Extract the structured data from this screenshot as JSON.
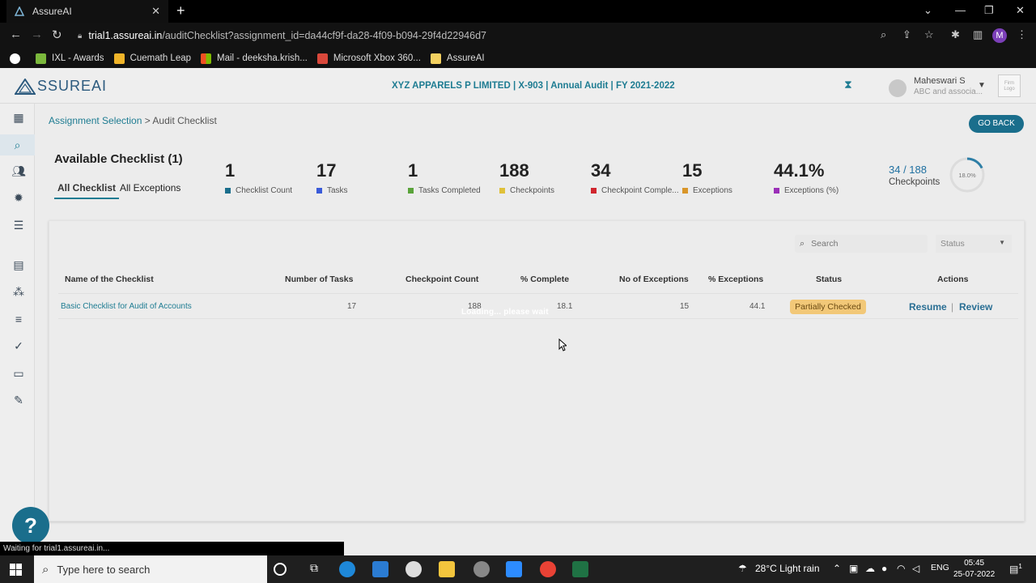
{
  "browser": {
    "tab_title": "AssureAI",
    "url_domain": "trial1.assureai.in",
    "url_path": "/auditChecklist?assignment_id=da44cf9f-da28-4f09-b094-29f4d22946d7",
    "profile_initial": "M",
    "bookmarks": [
      "IXL - Awards",
      "Cuemath Leap",
      "Mail - deeksha.krish...",
      "Microsoft Xbox 360...",
      "AssureAI"
    ],
    "status_text": "Waiting for trial1.assureai.in..."
  },
  "app": {
    "logo_text": "SSUREAI",
    "context": "XYZ APPARELS P LIMITED | X-903 | Annual Audit | FY 2021-2022",
    "user_name": "Maheswari S",
    "user_org": "ABC and associa...",
    "firm_logo_text": "Firm Logo"
  },
  "breadcrumb": {
    "link": "Assignment Selection",
    "sep": " > ",
    "current": "Audit Checklist"
  },
  "go_back_label": "GO BACK",
  "summary": {
    "title": "Available Checklist (1)",
    "tabs": [
      "All Checklist",
      "All Exceptions"
    ],
    "stats": [
      {
        "value": "1",
        "label": "Checklist Count",
        "color": "#1a6e8c"
      },
      {
        "value": "17",
        "label": "Tasks",
        "color": "#3a5bd9"
      },
      {
        "value": "1",
        "label": "Tasks Completed",
        "color": "#5aa33a"
      },
      {
        "value": "188",
        "label": "Checkpoints",
        "color": "#e0c13a"
      },
      {
        "value": "34",
        "label": "Checkpoint Comple...",
        "color": "#d0262e"
      },
      {
        "value": "15",
        "label": "Exceptions",
        "color": "#d9962a"
      },
      {
        "value": "44.1%",
        "label": "Exceptions (%)",
        "color": "#9b2fb8"
      }
    ],
    "checkpoint_progress": "34 / 188",
    "checkpoint_label": "Checkpoints",
    "ring_percent": "18.0%",
    "ring_fraction": 0.18
  },
  "filters": {
    "search_placeholder": "Search",
    "status_label": "Status"
  },
  "table": {
    "headers": [
      "Name of the Checklist",
      "Number of Tasks",
      "Checkpoint Count",
      "% Complete",
      "No of Exceptions",
      "% Exceptions",
      "Status",
      "Actions"
    ],
    "rows": [
      {
        "name": "Basic Checklist for Audit of Accounts",
        "tasks": "17",
        "checkpoints": "188",
        "complete": "18.1",
        "exceptions": "15",
        "exceptions_pct": "44.1",
        "status": "Partially Checked",
        "actions": [
          "Resume",
          "Review"
        ]
      }
    ]
  },
  "loading_text": "Loading... please wait",
  "taskbar": {
    "search_placeholder": "Type here to search",
    "weather": "28°C  Light rain",
    "lang": "ENG",
    "time": "05:45",
    "date": "25-07-2022",
    "notifications": "1"
  }
}
